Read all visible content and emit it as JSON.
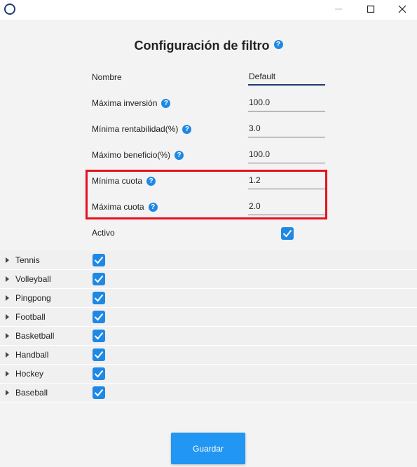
{
  "window": {
    "minimize_icon": "minimize-icon",
    "maximize_icon": "maximize-icon",
    "close_icon": "close-icon"
  },
  "header": {
    "title": "Configuración de filtro"
  },
  "form": {
    "nombre": {
      "label": "Nombre",
      "value": "Default"
    },
    "max_inversion": {
      "label": "Máxima inversión",
      "value": "100.0"
    },
    "min_rentabilidad": {
      "label": "Mínima rentabilidad(%)",
      "value": "3.0"
    },
    "max_beneficio": {
      "label": "Máximo beneficio(%)",
      "value": "100.0"
    },
    "min_cuota": {
      "label": "Mínima cuota",
      "value": "1.2"
    },
    "max_cuota": {
      "label": "Máxima cuota",
      "value": "2.0"
    },
    "activo": {
      "label": "Activo",
      "checked": true
    }
  },
  "sports": [
    {
      "name": "Tennis",
      "checked": true
    },
    {
      "name": "Volleyball",
      "checked": true
    },
    {
      "name": "Pingpong",
      "checked": true
    },
    {
      "name": "Football",
      "checked": true
    },
    {
      "name": "Basketball",
      "checked": true
    },
    {
      "name": "Handball",
      "checked": true
    },
    {
      "name": "Hockey",
      "checked": true
    },
    {
      "name": "Baseball",
      "checked": true
    }
  ],
  "actions": {
    "save_label": "Guardar"
  },
  "help_glyph": "?",
  "colors": {
    "accent": "#1e88e5",
    "button": "#2196f3",
    "highlight": "#e3121f",
    "focus": "#1f3b73"
  }
}
